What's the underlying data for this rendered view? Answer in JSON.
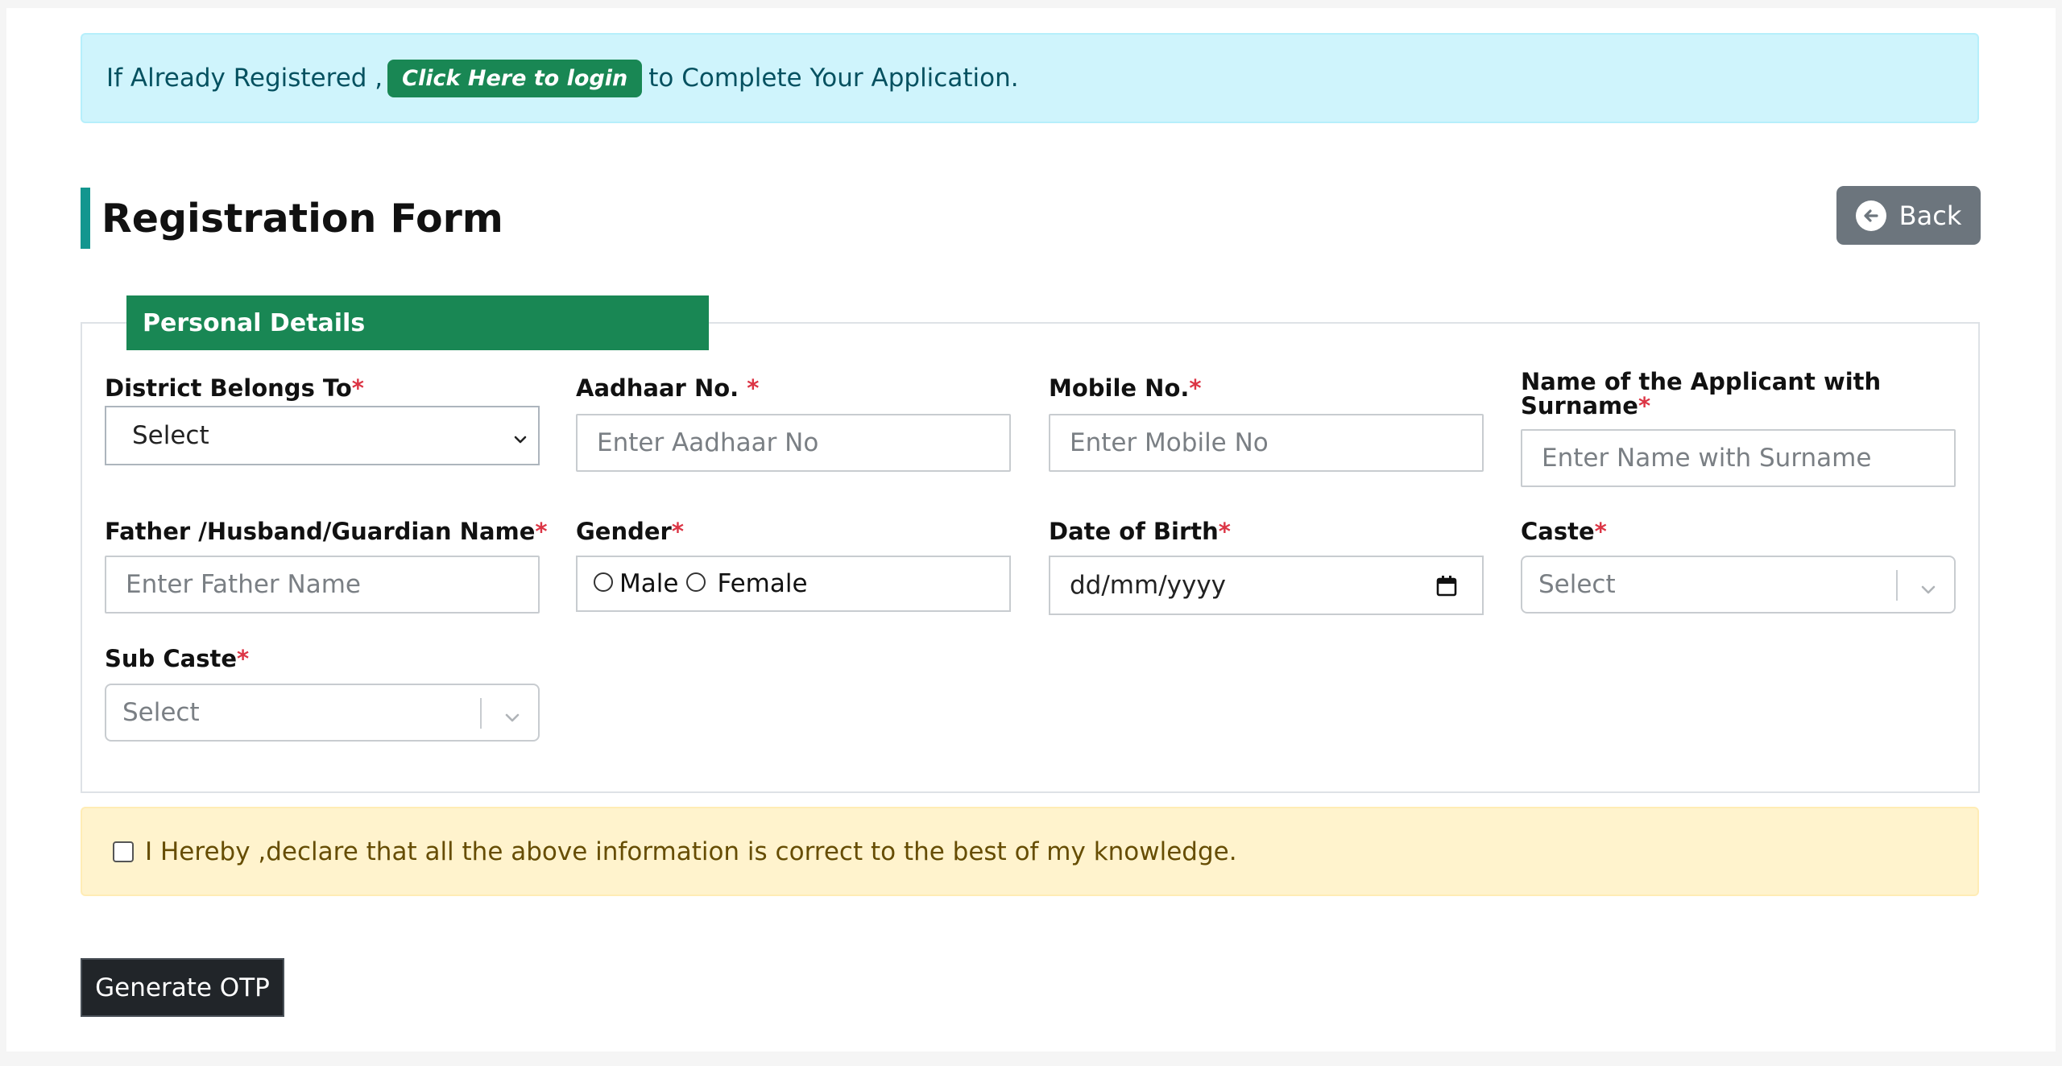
{
  "alert_login": {
    "prefix": "If Already Registered ,",
    "button_label": "Click Here to login",
    "suffix": "to Complete Your Application."
  },
  "header": {
    "title": "Registration Form",
    "back_label": "Back"
  },
  "section": {
    "legend": "Personal Details"
  },
  "fields": {
    "district": {
      "label": "District Belongs To",
      "required_mark": "*",
      "value": "Select"
    },
    "aadhaar": {
      "label": "Aadhaar No. ",
      "required_mark": "*",
      "placeholder": "Enter Aadhaar No"
    },
    "mobile": {
      "label": "Mobile No.",
      "required_mark": "*",
      "placeholder": "Enter Mobile No"
    },
    "applicant_name": {
      "label_line1": "Name of the Applicant with",
      "label_line2": "Surname",
      "required_mark": "*",
      "placeholder": "Enter Name with Surname"
    },
    "father_name": {
      "label": "Father /Husband/Guardian Name",
      "required_mark": "*",
      "placeholder": "Enter Father Name"
    },
    "gender": {
      "label": "Gender",
      "required_mark": "*",
      "options": [
        "Male",
        "Female"
      ]
    },
    "dob": {
      "label": "Date of Birth",
      "required_mark": "*",
      "value": "dd/mm/yyyy"
    },
    "caste": {
      "label": "Caste",
      "required_mark": "*",
      "placeholder": "Select"
    },
    "sub_caste": {
      "label": "Sub Caste",
      "required_mark": "*",
      "placeholder": "Select"
    }
  },
  "declaration": {
    "text": "I Hereby ,declare that all the above information is correct to the best of my knowledge."
  },
  "actions": {
    "generate_otp_label": "Generate OTP"
  },
  "colors": {
    "accent_green": "#198754",
    "title_bar_teal": "#13968f",
    "info_bg": "#cff4fc",
    "warning_bg": "#fff3cd",
    "back_button": "#6c757d",
    "required": "#dc3545",
    "dark_button": "#212529"
  },
  "icons": {
    "back": "arrow-left-circle-icon",
    "dropdown": "chevron-down-icon",
    "calendar": "calendar-icon"
  }
}
